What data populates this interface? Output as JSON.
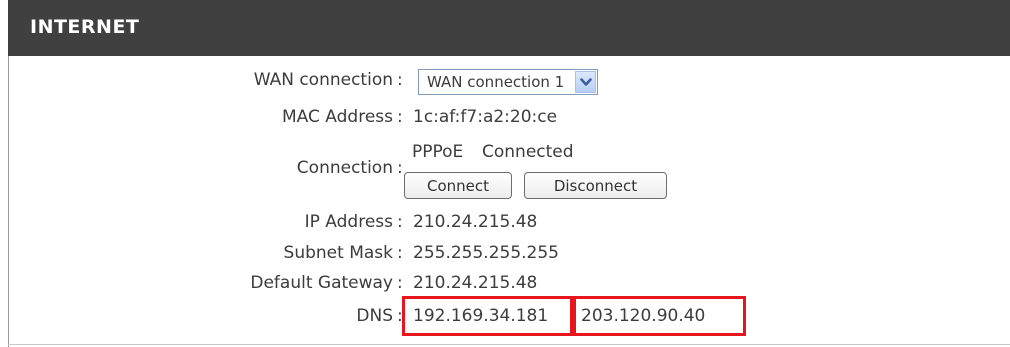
{
  "section": {
    "title": "INTERNET"
  },
  "wan_connection": {
    "label": "WAN connection",
    "selected": "WAN connection 1"
  },
  "mac_address": {
    "label": "MAC Address",
    "value": "1c:af:f7:a2:20:ce"
  },
  "connection": {
    "label": "Connection",
    "type": "PPPoE",
    "status": "Connected",
    "connect_label": "Connect",
    "disconnect_label": "Disconnect"
  },
  "ip_address": {
    "label": "IP Address",
    "value": "210.24.215.48"
  },
  "subnet_mask": {
    "label": "Subnet Mask",
    "value": "255.255.255.255"
  },
  "default_gateway": {
    "label": "Default Gateway",
    "value": "210.24.215.48"
  },
  "dns": {
    "label": "DNS",
    "primary": "192.169.34.181",
    "secondary": "203.120.90.40"
  },
  "colors": {
    "header_bg": "#404040",
    "highlight": "#e5161d"
  },
  "colon": ":"
}
